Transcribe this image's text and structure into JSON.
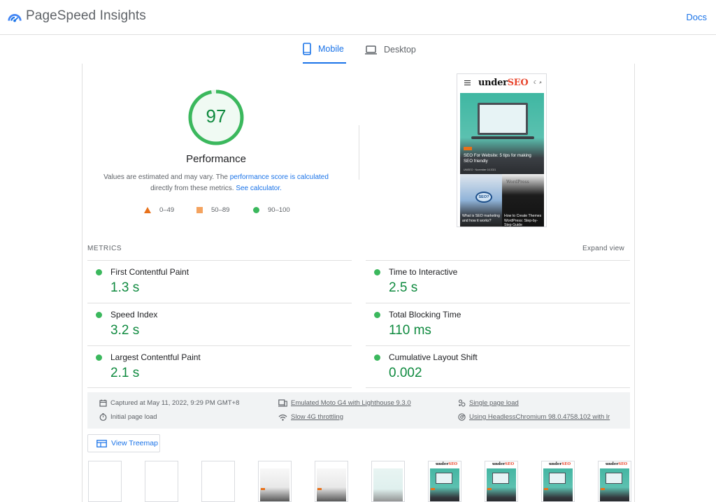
{
  "header": {
    "app_title": "PageSpeed Insights",
    "docs_label": "Docs",
    "logo_icon": "pagespeed-gauge-icon"
  },
  "tabs": [
    {
      "label": "Mobile",
      "icon": "phone-icon",
      "active": true
    },
    {
      "label": "Desktop",
      "icon": "laptop-icon",
      "active": false
    }
  ],
  "score": {
    "value": "97",
    "score_fraction": 0.97,
    "category": "Performance",
    "note_prefix": "Values are estimated and may vary. The ",
    "note_link1": "performance score is calculated",
    "note_middle": " directly from these metrics. ",
    "note_link2": "See calculator.",
    "colors": {
      "pass": "#0cce6b",
      "average": "#ffa400",
      "fail": "#ff4e42"
    }
  },
  "legend": [
    {
      "shape": "triangle",
      "label": "0–49"
    },
    {
      "shape": "square",
      "label": "50–89"
    },
    {
      "shape": "circle",
      "label": "90–100"
    }
  ],
  "screenshot": {
    "brand_dark": "under",
    "brand_accent": "SEO",
    "hero_title": "SEO For Website: 5 tips for making SEO friendly",
    "hero_meta": "UNISEO · November 16 2021",
    "card1_bubble": "SEO?",
    "card1_title": "What is SEO marketing and how it works?",
    "card2_logo": "WordPress",
    "card2_title": "How to Create Themes WordPress: Step-by-Step Guide"
  },
  "metrics": {
    "section_label": "METRICS",
    "expand_label": "Expand view",
    "items": [
      {
        "name": "First Contentful Paint",
        "value": "1.3 s",
        "status": "pass"
      },
      {
        "name": "Time to Interactive",
        "value": "2.5 s",
        "status": "pass"
      },
      {
        "name": "Speed Index",
        "value": "3.2 s",
        "status": "pass"
      },
      {
        "name": "Total Blocking Time",
        "value": "110 ms",
        "status": "pass"
      },
      {
        "name": "Largest Contentful Paint",
        "value": "2.1 s",
        "status": "pass"
      },
      {
        "name": "Cumulative Layout Shift",
        "value": "0.002",
        "status": "pass"
      }
    ]
  },
  "info": {
    "captured": "Captured at May 11, 2022, 9:29 PM GMT+8",
    "initial_load": "Initial page load",
    "device": "Emulated Moto G4 with Lighthouse 9.3.0",
    "throttling": "Slow 4G throttling",
    "single_load": "Single page load",
    "browser": "Using HeadlessChromium 98.0.4758.102 with lr"
  },
  "treemap": {
    "label": "View Treemap"
  },
  "filmstrip": {
    "brand_dark": "under",
    "brand_accent": "SEO",
    "frames": [
      "blank",
      "blank",
      "blank",
      "light",
      "light",
      "mint",
      "teal",
      "teal",
      "teal",
      "teal"
    ]
  }
}
